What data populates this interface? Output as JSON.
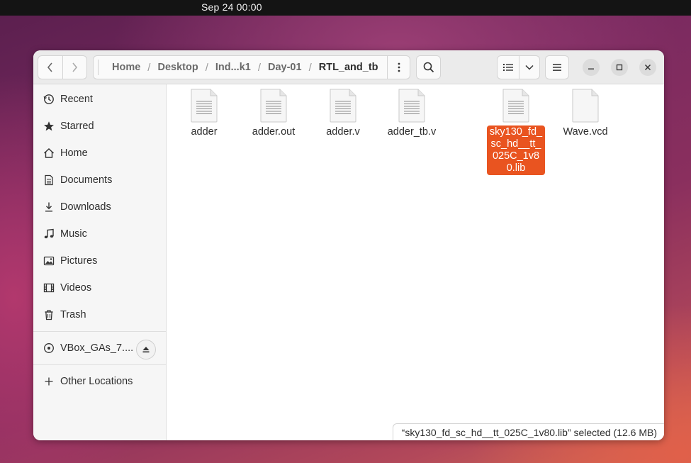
{
  "topbar": {
    "clock": "Sep 24  00:00"
  },
  "header": {
    "back_icon": "chevron-left-icon",
    "forward_icon": "chevron-right-icon",
    "breadcrumbs": [
      "Home",
      "Desktop",
      "Ind...k1",
      "Day-01",
      "RTL_and_tb"
    ],
    "path_menu_icon": "vertical-ellipsis-icon",
    "search_icon": "search-icon",
    "view_icon": "list-view-icon",
    "view_dropdown_icon": "chevron-down-icon",
    "main_menu_icon": "hamburger-menu-icon",
    "window_controls": [
      "minimize",
      "maximize",
      "close"
    ]
  },
  "sidebar": {
    "items": [
      {
        "label": "Recent",
        "icon": "clock-icon"
      },
      {
        "label": "Starred",
        "icon": "star-icon"
      },
      {
        "label": "Home",
        "icon": "home-icon"
      },
      {
        "label": "Documents",
        "icon": "document-icon"
      },
      {
        "label": "Downloads",
        "icon": "download-icon"
      },
      {
        "label": "Music",
        "icon": "music-icon"
      },
      {
        "label": "Pictures",
        "icon": "picture-icon"
      },
      {
        "label": "Videos",
        "icon": "video-icon"
      },
      {
        "label": "Trash",
        "icon": "trash-icon"
      }
    ],
    "devices": [
      {
        "label": "VBox_GAs_7....",
        "icon": "disc-icon",
        "action_icon": "eject-icon"
      }
    ],
    "other": {
      "label": "Other Locations",
      "icon": "plus-icon"
    }
  },
  "files": [
    {
      "name": "adder",
      "icon": "text-file-icon",
      "selected": false
    },
    {
      "name": "adder.out",
      "icon": "text-file-icon",
      "selected": false
    },
    {
      "name": "adder.v",
      "icon": "text-file-icon",
      "selected": false
    },
    {
      "name": "adder_tb.v",
      "icon": "text-file-icon",
      "selected": false
    },
    {
      "name": "sky130_fd_sc_hd__tt_025C_1v80.lib",
      "icon": "text-file-icon",
      "selected": true
    },
    {
      "name": "Wave.vcd",
      "icon": "blank-file-icon",
      "selected": false
    }
  ],
  "status": "“sky130_fd_sc_hd__tt_025C_1v80.lib” selected  (12.6 MB)",
  "colors": {
    "accent": "#e95420",
    "topbar": "#141414"
  }
}
